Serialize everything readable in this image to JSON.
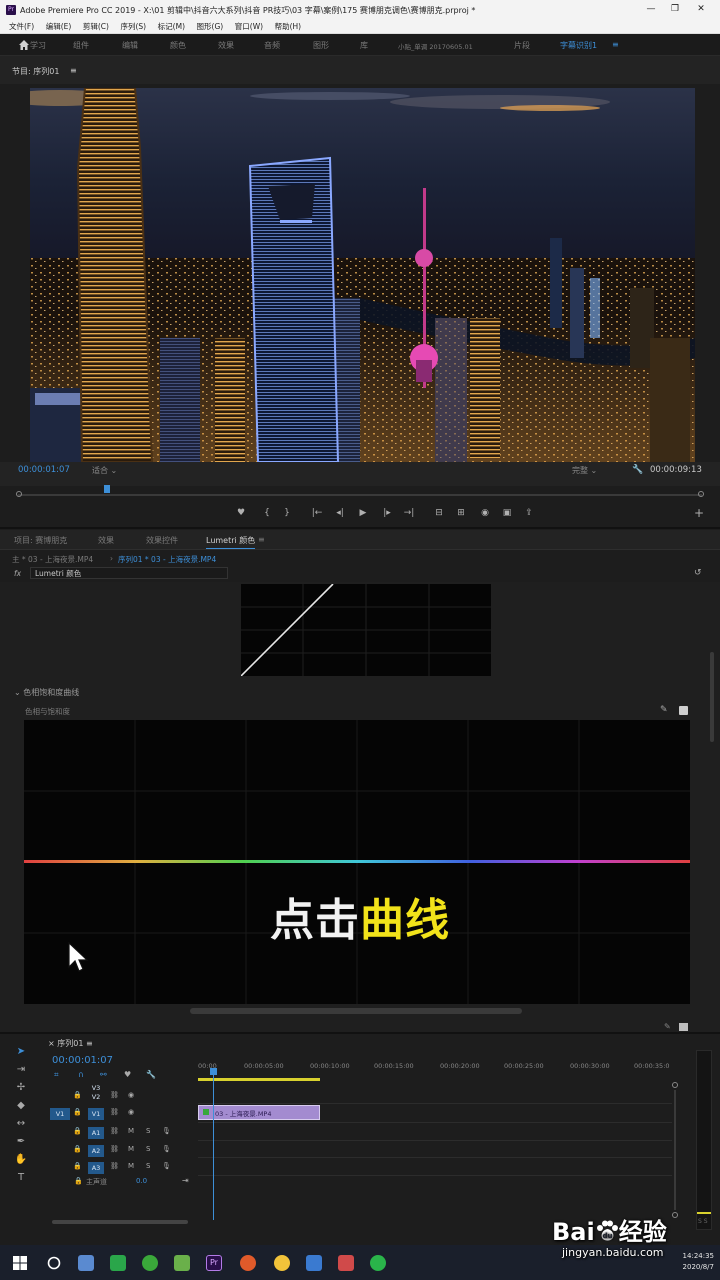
{
  "titlebar": {
    "app_title": "Adobe Premiere Pro CC 2019 - X:\\01 剪辑中\\抖音六大系列\\抖音 PR技巧\\03 字幕\\案例\\175 赛博朋克调色\\赛博朋克.prproj *",
    "minimize": "—",
    "maximize": "❐",
    "close": "✕"
  },
  "menubar": [
    "文件(F)",
    "编辑(E)",
    "剪辑(C)",
    "序列(S)",
    "标记(M)",
    "图形(G)",
    "窗口(W)",
    "帮助(H)"
  ],
  "workspaces": [
    {
      "label": "学习",
      "active": false
    },
    {
      "label": "组件",
      "active": false
    },
    {
      "label": "编辑",
      "active": false
    },
    {
      "label": "颜色",
      "active": false
    },
    {
      "label": "效果",
      "active": false
    },
    {
      "label": "音频",
      "active": false
    },
    {
      "label": "图形",
      "active": false
    },
    {
      "label": "库",
      "active": false
    },
    {
      "label": "小贴_单调 20170605.01",
      "active": false
    },
    {
      "label": "片段",
      "active": false
    },
    {
      "label": "字幕识别1",
      "active": true
    }
  ],
  "program_monitor": {
    "tab": "节目: 序列01",
    "timecode_current": "00:00:01:07",
    "fit": "适合",
    "quality": "完整",
    "timecode_duration": "00:00:09:13"
  },
  "transport": {
    "marker": "♥",
    "in": "{",
    "out": "}",
    "goto_in": "|←",
    "step_back": "◂|",
    "play": "▶",
    "step_fwd": "|▸",
    "goto_out": "→|",
    "lift": "⊟",
    "extract": "⊞",
    "export_frame": "◉",
    "compare": "▣",
    "share": "⇪",
    "add": "+"
  },
  "lumetri": {
    "tabs": [
      {
        "label": "项目: 赛博朋克",
        "active": false
      },
      {
        "label": "效果",
        "active": false
      },
      {
        "label": "效果控件",
        "active": false
      },
      {
        "label": "Lumetri 颜色",
        "active": true
      }
    ],
    "master_clip": "主 * 03 - 上海夜景.MP4",
    "sequence_clip": "序列01 * 03 - 上海夜景.MP4",
    "fx_label": "fx",
    "effect_name": "Lumetri 颜色",
    "reset": "↺",
    "section_title": "色相饱和度曲线",
    "sub_label": "色相与饱和度",
    "eyedropper": "✎"
  },
  "caption": {
    "part1": "点击",
    "part2": "曲线"
  },
  "timeline": {
    "tab": "序列01",
    "timecode": "00:00:01:07",
    "ruler": [
      "00:00",
      "00:00:05:00",
      "00:00:10:00",
      "00:00:15:00",
      "00:00:20:00",
      "00:00:25:00",
      "00:00:30:00",
      "00:00:35:0"
    ],
    "tracks": {
      "v3": "V3",
      "v2": "V2",
      "v1": "V1",
      "a1": "A1",
      "a2": "A2",
      "a3": "A3",
      "src_v": "V1"
    },
    "clip_name": "03 - 上海夜景.MP4",
    "master": "主声道",
    "master_value": "0.0",
    "meter_label": "S S"
  },
  "taskbar": {
    "time": "14:24:35",
    "date": "2020/8/7"
  },
  "watermark": {
    "brand": "Bai",
    "brand_cn": "经验",
    "du": "du",
    "url": "jingyan.baidu.com"
  },
  "colors": {
    "accent": "#3d8fd8",
    "caption_yellow": "#f2e31a",
    "clip_purple": "#a38bd0"
  }
}
